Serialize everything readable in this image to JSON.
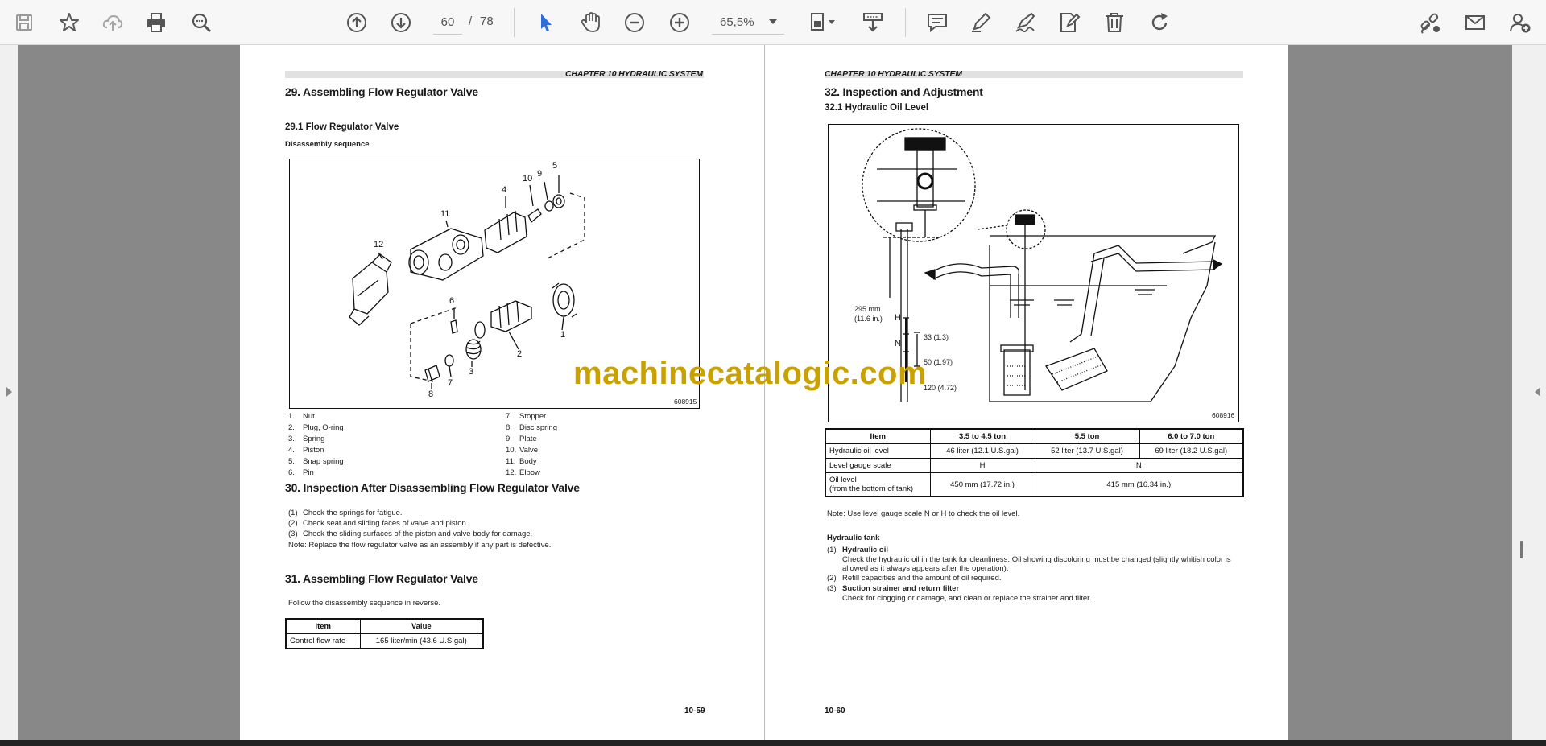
{
  "toolbar": {
    "page_current": "60",
    "page_separator": "/",
    "page_total": "78",
    "zoom": "65,5%"
  },
  "left_page": {
    "chapter_header": "CHAPTER 10 HYDRAULIC SYSTEM",
    "sec29_title": "29.  Assembling Flow Regulator Valve",
    "sub29_1": "29.1    Flow Regulator Valve",
    "disassembly_label": "Disassembly sequence",
    "figure_number": "608915",
    "callouts": [
      "1",
      "2",
      "3",
      "4",
      "5",
      "6",
      "7",
      "8",
      "9",
      "10",
      "11",
      "12"
    ],
    "parts_left": [
      {
        "num": "1.",
        "name": "Nut"
      },
      {
        "num": "2.",
        "name": "Plug, O-ring"
      },
      {
        "num": "3.",
        "name": "Spring"
      },
      {
        "num": "4.",
        "name": "Piston"
      },
      {
        "num": "5.",
        "name": "Snap spring"
      },
      {
        "num": "6.",
        "name": "Pin"
      }
    ],
    "parts_right": [
      {
        "num": "7.",
        "name": "Stopper"
      },
      {
        "num": "8.",
        "name": "Disc spring"
      },
      {
        "num": "9.",
        "name": "Plate"
      },
      {
        "num": "10.",
        "name": "Valve"
      },
      {
        "num": "11.",
        "name": "Body"
      },
      {
        "num": "12.",
        "name": "Elbow"
      }
    ],
    "sec30_title": "30.  Inspection After Disassembling Flow Regulator Valve",
    "sec30_items": [
      {
        "num": "(1)",
        "text": "Check the springs for fatigue."
      },
      {
        "num": "(2)",
        "text": "Check seat and sliding faces of valve and piston."
      },
      {
        "num": "(3)",
        "text": "Check the sliding surfaces of the piston and valve body for damage."
      }
    ],
    "sec30_note": "Note: Replace the flow regulator valve as an assembly if any part is defective.",
    "sec31_title": "31.  Assembling Flow Regulator Valve",
    "sec31_text": "Follow the disassembly sequence in reverse.",
    "table": {
      "headers": [
        "Item",
        "Value"
      ],
      "rows": [
        [
          "Control flow rate",
          "165 liter/min (43.6 U.S.gal)"
        ]
      ]
    },
    "page_number": "10-59"
  },
  "right_page": {
    "chapter_header": "CHAPTER 10 HYDRAULIC SYSTEM",
    "sec32_title": "32.  Inspection and Adjustment",
    "sub32_1": "32.1    Hydraulic Oil Level",
    "figure_number": "608916",
    "fig_labels": {
      "dim_295": "295 mm",
      "dim_295_in": "(11.6 in.)",
      "h": "H",
      "n": "N",
      "dim_33": "33 (1.3)",
      "dim_50": "50 (1.97)",
      "dim_120": "120 (4.72)"
    },
    "table": {
      "headers": [
        "Item",
        "3.5 to 4.5 ton",
        "5.5 ton",
        "6.0 to 7.0 ton"
      ],
      "row1": [
        "Hydraulic oil level",
        "46 liter (12.1 U.S.gal)",
        "52 liter (13.7 U.S.gal)",
        "69 liter (18.2 U.S.gal)"
      ],
      "row2": [
        "Level gauge scale",
        "H",
        "N"
      ],
      "row3_item_line1": "Oil level",
      "row3_item_line2": "(from the bottom of tank)",
      "row3_values": [
        "450 mm (17.72 in.)",
        "415 mm (16.34 in.)"
      ]
    },
    "note": "Note: Use level gauge scale N or H to check the oil level.",
    "tank_heading": "Hydraulic tank",
    "tank_items": [
      {
        "num": "(1)",
        "title": "Hydraulic oil",
        "text1": "Check the hydraulic oil in the tank for cleanliness. Oil showing discoloring must be changed (slightly whitish color is",
        "text2": "allowed as it always appears after the operation)."
      },
      {
        "num": "(2)",
        "text": "Refill capacities and the amount of oil required."
      },
      {
        "num": "(3)",
        "title": "Suction strainer and return filter",
        "text1": "Check for clogging or damage, and clean or replace the strainer and filter."
      }
    ],
    "page_number": "10-60"
  },
  "watermark": "machinecatalogic.com",
  "colors": {
    "toolbar_bg": "#f7f7f7",
    "viewer_bg": "#888888",
    "accent_blue": "#2f6ed8",
    "watermark": "#c9a100"
  },
  "icons": [
    "save-icon",
    "bookmark-star-icon",
    "upload-cloud-icon",
    "print-icon",
    "zoom-search-icon",
    "page-up-icon",
    "page-down-icon",
    "zoom-out-icon",
    "zoom-in-icon",
    "select-cursor-icon",
    "hand-pan-icon",
    "page-fit-icon",
    "download-tray-icon",
    "comment-icon",
    "highlight-pen-icon",
    "sign-pen-icon",
    "edit-document-icon",
    "delete-trash-icon",
    "rotate-icon",
    "share-link-icon",
    "email-icon",
    "add-user-icon"
  ]
}
